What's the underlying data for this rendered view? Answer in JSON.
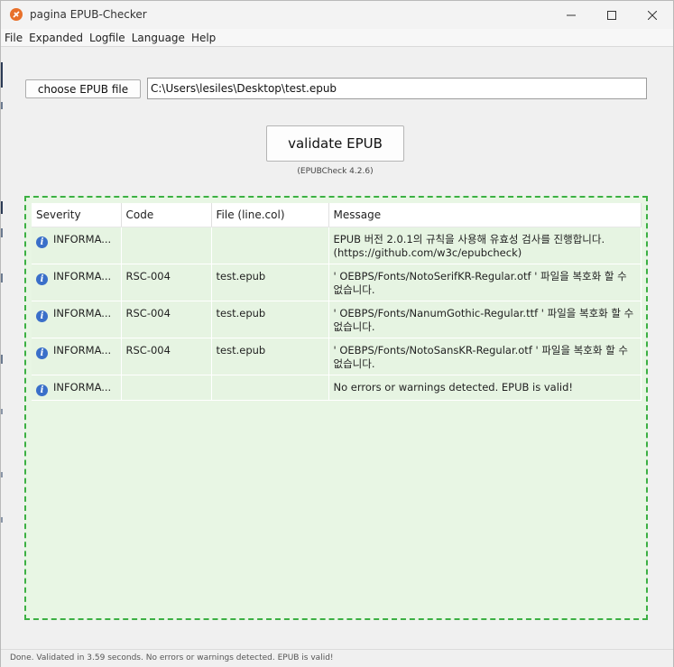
{
  "window": {
    "title": "pagina EPUB-Checker"
  },
  "menu": [
    {
      "name": "menu-file",
      "label": "File"
    },
    {
      "name": "menu-expanded",
      "label": "Expanded"
    },
    {
      "name": "menu-logfile",
      "label": "Logfile"
    },
    {
      "name": "menu-language",
      "label": "Language"
    },
    {
      "name": "menu-help",
      "label": "Help"
    }
  ],
  "controls": {
    "choose_label": "choose EPUB file",
    "path_value": "C:\\Users\\lesiles\\Desktop\\test.epub",
    "validate_label": "validate EPUB",
    "version": "(EPUBCheck 4.2.6)"
  },
  "table": {
    "headers": {
      "severity": "Severity",
      "code": "Code",
      "file": "File (line.col)",
      "message": "Message"
    },
    "rows": [
      {
        "severity": "INFORMA...",
        "code": "",
        "file": "",
        "message": "EPUB 버전 2.0.1의 규칙을 사용해 유효성 검사를 진행합니다. (https://github.com/w3c/epubcheck)",
        "double": true
      },
      {
        "severity": "INFORMA...",
        "code": "RSC-004",
        "file": "test.epub",
        "message": "' OEBPS/Fonts/NotoSerifKR-Regular.otf ' 파일을 복호화 할 수 없습니다.",
        "double": true
      },
      {
        "severity": "INFORMA...",
        "code": "RSC-004",
        "file": "test.epub",
        "message": "' OEBPS/Fonts/NanumGothic-Regular.ttf ' 파일을 복호화 할 수 없습니다.",
        "double": true
      },
      {
        "severity": "INFORMA...",
        "code": "RSC-004",
        "file": "test.epub",
        "message": "' OEBPS/Fonts/NotoSansKR-Regular.otf ' 파일을 복호화 할 수 없습니다.",
        "double": true
      },
      {
        "severity": "INFORMA...",
        "code": "",
        "file": "",
        "message": "No errors or warnings detected. EPUB is valid!",
        "double": false
      }
    ]
  },
  "status": {
    "text": "Done. Validated in 3.59 seconds. No errors or warnings detected. EPUB is valid!"
  },
  "colors": {
    "panel_border": "#3cb043",
    "panel_bg": "#e8f6e4",
    "info_icon": "#3a6fc9",
    "app_icon": "#e8702a"
  }
}
